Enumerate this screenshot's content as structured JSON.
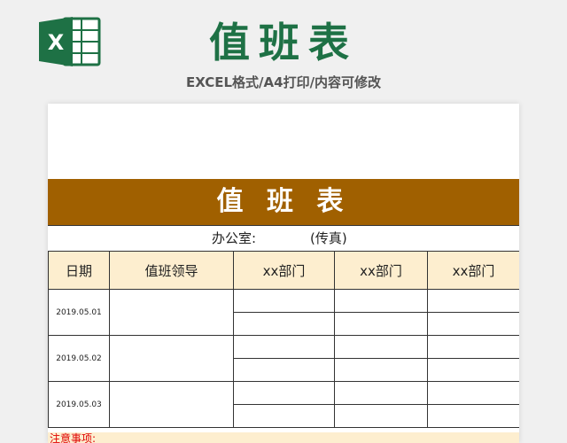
{
  "header": {
    "title": "值班表",
    "subtitle": "EXCEL格式/A4打印/内容可修改",
    "logo_letter": "X"
  },
  "sheet": {
    "banner_title": "值 班 表",
    "office_label": "办公室:",
    "fax_label": "(传真)",
    "columns": [
      "日期",
      "值班领导",
      "xx部门",
      "xx部门",
      "xx部门"
    ],
    "rows": [
      {
        "date": "2019.05.01"
      },
      {
        "date": "2019.05.02"
      },
      {
        "date": "2019.05.03"
      }
    ],
    "notes_label": "注意事项:"
  },
  "colors": {
    "excel_green": "#1e7145",
    "banner_brown": "#a06000",
    "header_cream": "#fdeecf",
    "note_red": "#e00000"
  }
}
